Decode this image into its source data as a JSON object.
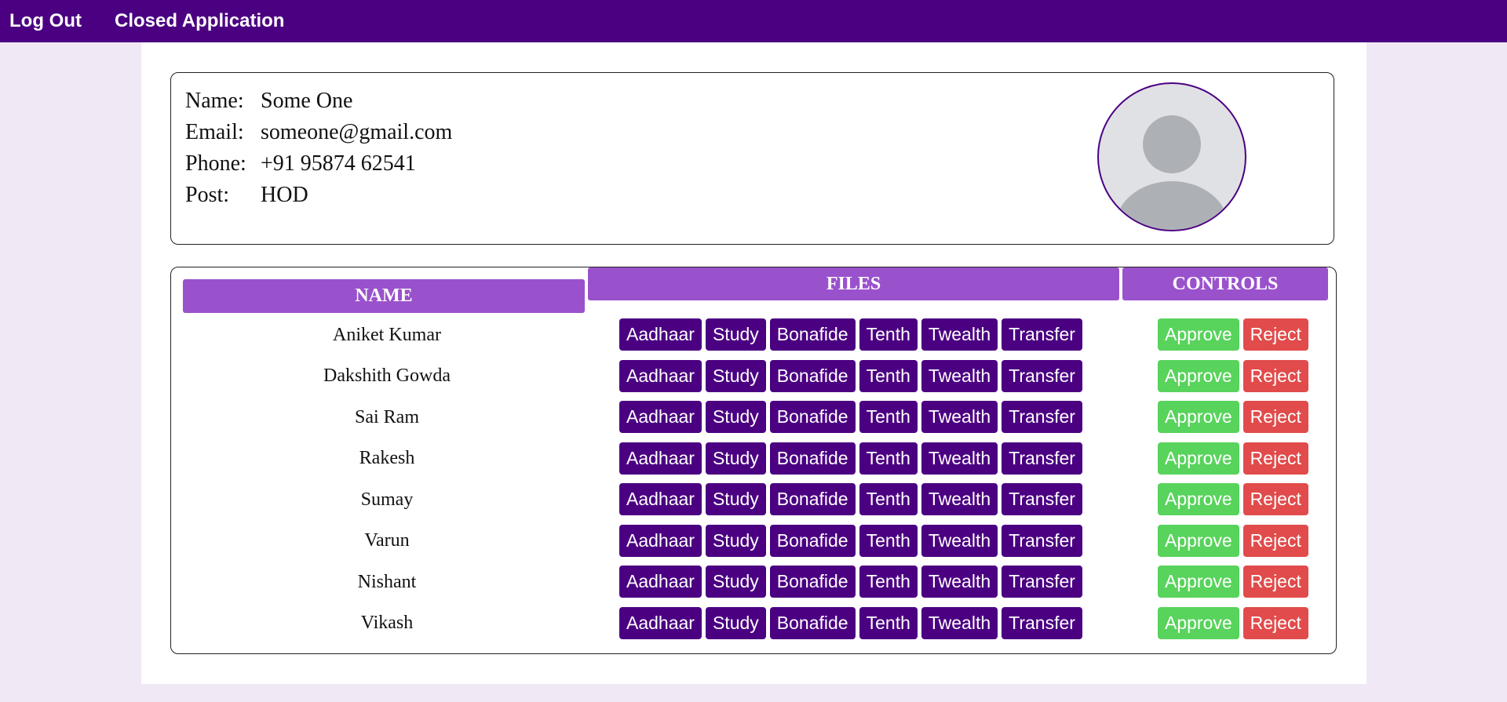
{
  "nav": {
    "logout_label": "Log Out",
    "closed_label": "Closed Application"
  },
  "profile": {
    "name_label": "Name:",
    "name": "Some One",
    "email_label": "Email:",
    "email": "someone@gmail.com",
    "phone_label": "Phone:",
    "phone": "+91 95874 62541",
    "post_label": "Post:",
    "post": "HOD",
    "avatar_icon": "user-avatar-icon"
  },
  "table": {
    "headers": {
      "name": "NAME",
      "files": "FILES",
      "controls": "CONTROLS"
    },
    "file_buttons": [
      "Aadhaar",
      "Study",
      "Bonafide",
      "Tenth",
      "Twealth",
      "Transfer"
    ],
    "approve_label": "Approve",
    "reject_label": "Reject",
    "rows": [
      {
        "name": "Aniket Kumar"
      },
      {
        "name": "Dakshith Gowda"
      },
      {
        "name": "Sai Ram"
      },
      {
        "name": "Rakesh"
      },
      {
        "name": "Sumay"
      },
      {
        "name": "Varun"
      },
      {
        "name": "Nishant"
      },
      {
        "name": "Vikash"
      }
    ]
  },
  "colors": {
    "primary": "#4b0082",
    "header": "#9a52cc",
    "approve": "#58d35c",
    "reject": "#e14b4b",
    "background": "#f1e8f6"
  }
}
